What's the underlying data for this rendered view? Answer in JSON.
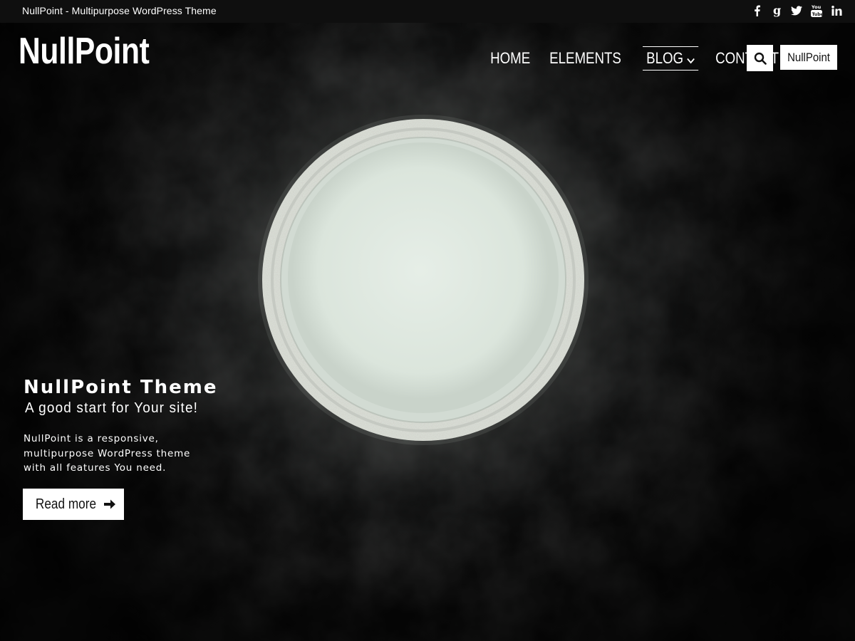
{
  "topbar": {
    "tagline": "NullPoint - Multipurpose WordPress Theme",
    "social": [
      "facebook-icon",
      "google-plus-icon",
      "twitter-icon",
      "youtube-icon",
      "linkedin-icon"
    ]
  },
  "header": {
    "logo": "NullPoint",
    "nav": [
      {
        "label": "HOME"
      },
      {
        "label": "ELEMENTS"
      },
      {
        "label": "BLOG",
        "has_dropdown": true,
        "active": true
      },
      {
        "label": "CONTACT"
      }
    ],
    "search_icon": "search-icon",
    "button_label": "NullPoint"
  },
  "hero": {
    "title": "NullPoint Theme",
    "subtitle": "A good start for Your site!",
    "description": "NullPoint is a responsive, multipurpose WordPress theme with all features You need.",
    "cta_label": "Read more",
    "cta_icon": "arrow-right-icon"
  },
  "colors": {
    "background": "#0d0d0d",
    "text": "#ffffff",
    "bowl_fill": "#e3ece4",
    "button_bg": "#ffffff"
  }
}
